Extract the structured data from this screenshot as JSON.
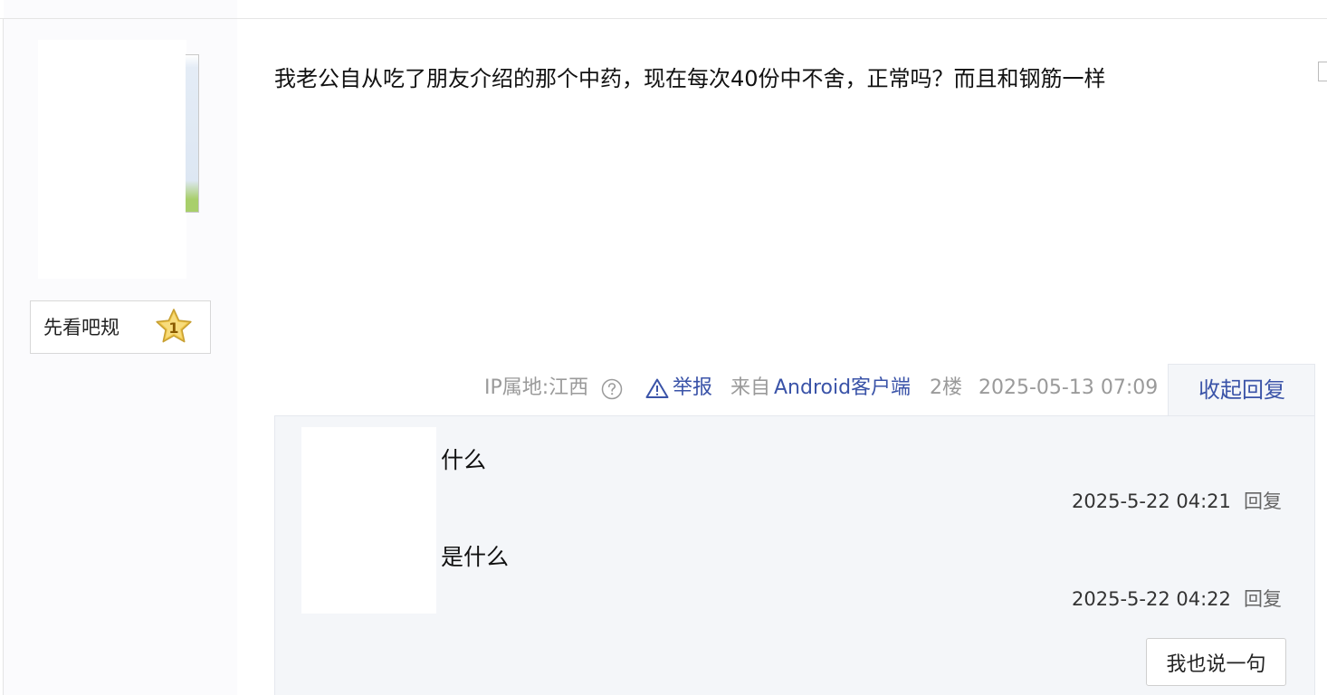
{
  "author_panel": {
    "badge_label": "先看吧规",
    "badge_level": "1"
  },
  "post": {
    "content": "我老公自从吃了朋友介绍的那个中药，现在每次40份中不舍，正常吗？而且和钢筋一样",
    "ip_location": "IP属地:江西",
    "report_label": "举报",
    "source_prefix": "来自",
    "source_client": "Android客户端",
    "floor": "2楼",
    "timestamp": "2025-05-13 07:09",
    "collapse_replies_label": "收起回复"
  },
  "replies": [
    {
      "text": "什么",
      "time": "2025-5-22 04:21",
      "reply_label": "回复"
    },
    {
      "text": "是什么",
      "time": "2025-5-22 04:22",
      "reply_label": "回复"
    }
  ],
  "reply_box": {
    "say_button_label": "我也说一句"
  },
  "colors": {
    "link_blue": "#3a53a8",
    "meta_gray": "#9a9a9a",
    "reply_bg": "#f4f6f9",
    "badge_star": "#f2c94c"
  },
  "icons": [
    "question-circle-icon",
    "warning-triangle-icon",
    "star-badge-icon"
  ]
}
